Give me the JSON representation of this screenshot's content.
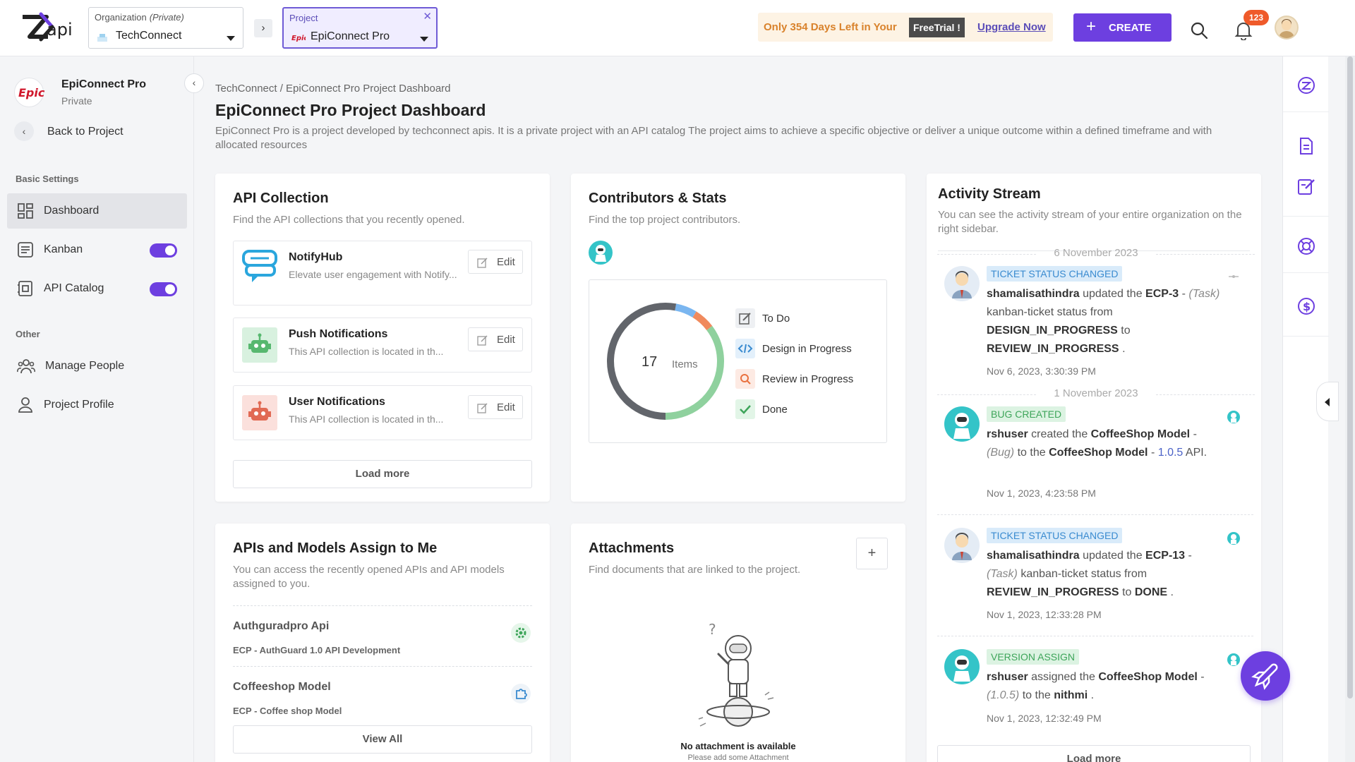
{
  "app": {
    "logo_text": "api"
  },
  "header": {
    "org_caption": "Organization",
    "org_caption_private": "(Private)",
    "org_value": "TechConnect",
    "project_caption": "Project",
    "project_value": "EpiConnect Pro",
    "trial_text": "Only 354 Days Left in Your",
    "trial_badge": "FreeTrial !",
    "upgrade_label": "Upgrade Now",
    "create_label": "CREATE",
    "notification_count": "123"
  },
  "sidebar": {
    "project_logo": "Epic",
    "project_name": "EpiConnect Pro",
    "project_visibility": "Private",
    "back_label": "Back to Project",
    "basic_settings_title": "Basic Settings",
    "items": [
      {
        "label": "Dashboard",
        "icon": "dashboard-icon",
        "active": true
      },
      {
        "label": "Kanban",
        "icon": "kanban-icon",
        "toggle": true
      },
      {
        "label": "API Catalog",
        "icon": "api-catalog-icon",
        "toggle": true
      }
    ],
    "other_title": "Other",
    "other_items": [
      {
        "label": "Manage People",
        "icon": "people-icon"
      },
      {
        "label": "Project Profile",
        "icon": "profile-icon"
      }
    ]
  },
  "main": {
    "breadcrumb": "TechConnect / EpiConnect Pro Project Dashboard",
    "title": "EpiConnect Pro Project Dashboard",
    "description": "EpiConnect Pro is a project developed by techconnect apis. It is a private project with an API catalog The project aims to achieve a specific objective or deliver a unique outcome within a defined timeframe and with allocated resources"
  },
  "api_collection": {
    "title": "API Collection",
    "subtitle": "Find the API collections that you recently opened.",
    "items": [
      {
        "name": "NotifyHub",
        "desc": "Elevate user engagement with Notify...",
        "icon": "notifyhub-icon",
        "edit": "Edit"
      },
      {
        "name": "Push Notifications",
        "desc": "This API collection is located in th...",
        "icon": "robot-green-icon",
        "edit": "Edit"
      },
      {
        "name": "User Notifications",
        "desc": "This API collection is located in th...",
        "icon": "robot-red-icon",
        "edit": "Edit"
      }
    ],
    "load_more": "Load more"
  },
  "contributors": {
    "title": "Contributors & Stats",
    "subtitle": "Find the top project contributors.",
    "total": "17",
    "total_label": "Items",
    "chart_data": {
      "type": "pie",
      "segments": [
        {
          "label": "To Do",
          "value": 0,
          "color": "#6b6b6b",
          "icon": "edit-icon"
        },
        {
          "label": "Design in Progress",
          "value": 1,
          "color": "#7ab6f0",
          "icon": "code-icon"
        },
        {
          "label": "Review in Progress",
          "value": 1,
          "color": "#f08a5d",
          "icon": "search-icon"
        },
        {
          "label": "Done",
          "value": 6,
          "color": "#8fd19e",
          "icon": "check-icon"
        },
        {
          "label": "",
          "value": 9,
          "color": "#62656b"
        }
      ]
    }
  },
  "assigned": {
    "title": "APIs and Models Assign to Me",
    "subtitle": "You can access the recently opened APIs and API models assigned to you.",
    "items": [
      {
        "name": "Authguradpro Api",
        "desc": "ECP - AuthGuard 1.0 API Development",
        "icon": "gear-icon"
      },
      {
        "name": "Coffeeshop Model",
        "desc": "ECP - Coffee shop Model",
        "icon": "puzzle-icon"
      }
    ],
    "view_all": "View All"
  },
  "attachments": {
    "title": "Attachments",
    "subtitle": "Find documents that are linked to the project.",
    "empty_title": "No attachment is available",
    "empty_sub": "Please add some Attachment"
  },
  "activity": {
    "title": "Activity Stream",
    "subtitle": "You can see the activity stream of your entire organization on the right sidebar.",
    "date1": "6 November 2023",
    "date2": "1 November 2023",
    "items": [
      {
        "tag": "TICKET STATUS CHANGED",
        "user": "shamalisathindra",
        "verb": "updated the",
        "target": "ECP-3",
        "dash": "-",
        "kind": "(Task)",
        "mid": "kanban-ticket status from",
        "from": "DESIGN_IN_PROGRESS",
        "to_word": "to",
        "to": "REVIEW_IN_PROGRESS",
        "end": ".",
        "when": "Nov 6, 2023, 3:30:39 PM"
      },
      {
        "tag": "BUG CREATED",
        "user": "rshuser",
        "verb": "created the",
        "target": "CoffeeShop Model",
        "dash": "-",
        "kind": "(Bug)",
        "mid": "to the",
        "model": "CoffeeShop Model",
        "dash2": "-",
        "version": "1.0.5",
        "end": "API.",
        "when": "Nov 1, 2023, 4:23:58 PM"
      },
      {
        "tag": "TICKET STATUS CHANGED",
        "user": "shamalisathindra",
        "verb": "updated the",
        "target": "ECP-13",
        "dash": "-",
        "kind": "(Task)",
        "mid": "kanban-ticket status from",
        "from": "REVIEW_IN_PROGRESS",
        "to_word": "to",
        "to": "DONE",
        "end": ".",
        "when": "Nov 1, 2023, 12:33:28 PM"
      },
      {
        "tag": "VERSION ASSIGN",
        "user": "rshuser",
        "verb": "assigned the",
        "target": "CoffeeShop Model",
        "dash": "-",
        "kind": "(1.0.5)",
        "mid": "to the",
        "assignee": "nithmi",
        "end": ".",
        "when": "Nov 1, 2023, 12:32:49 PM"
      }
    ],
    "load_more": "Load more"
  },
  "colors": {
    "accent": "#6d3fe0",
    "trial": "#d9822b",
    "link": "#5b4db8"
  }
}
